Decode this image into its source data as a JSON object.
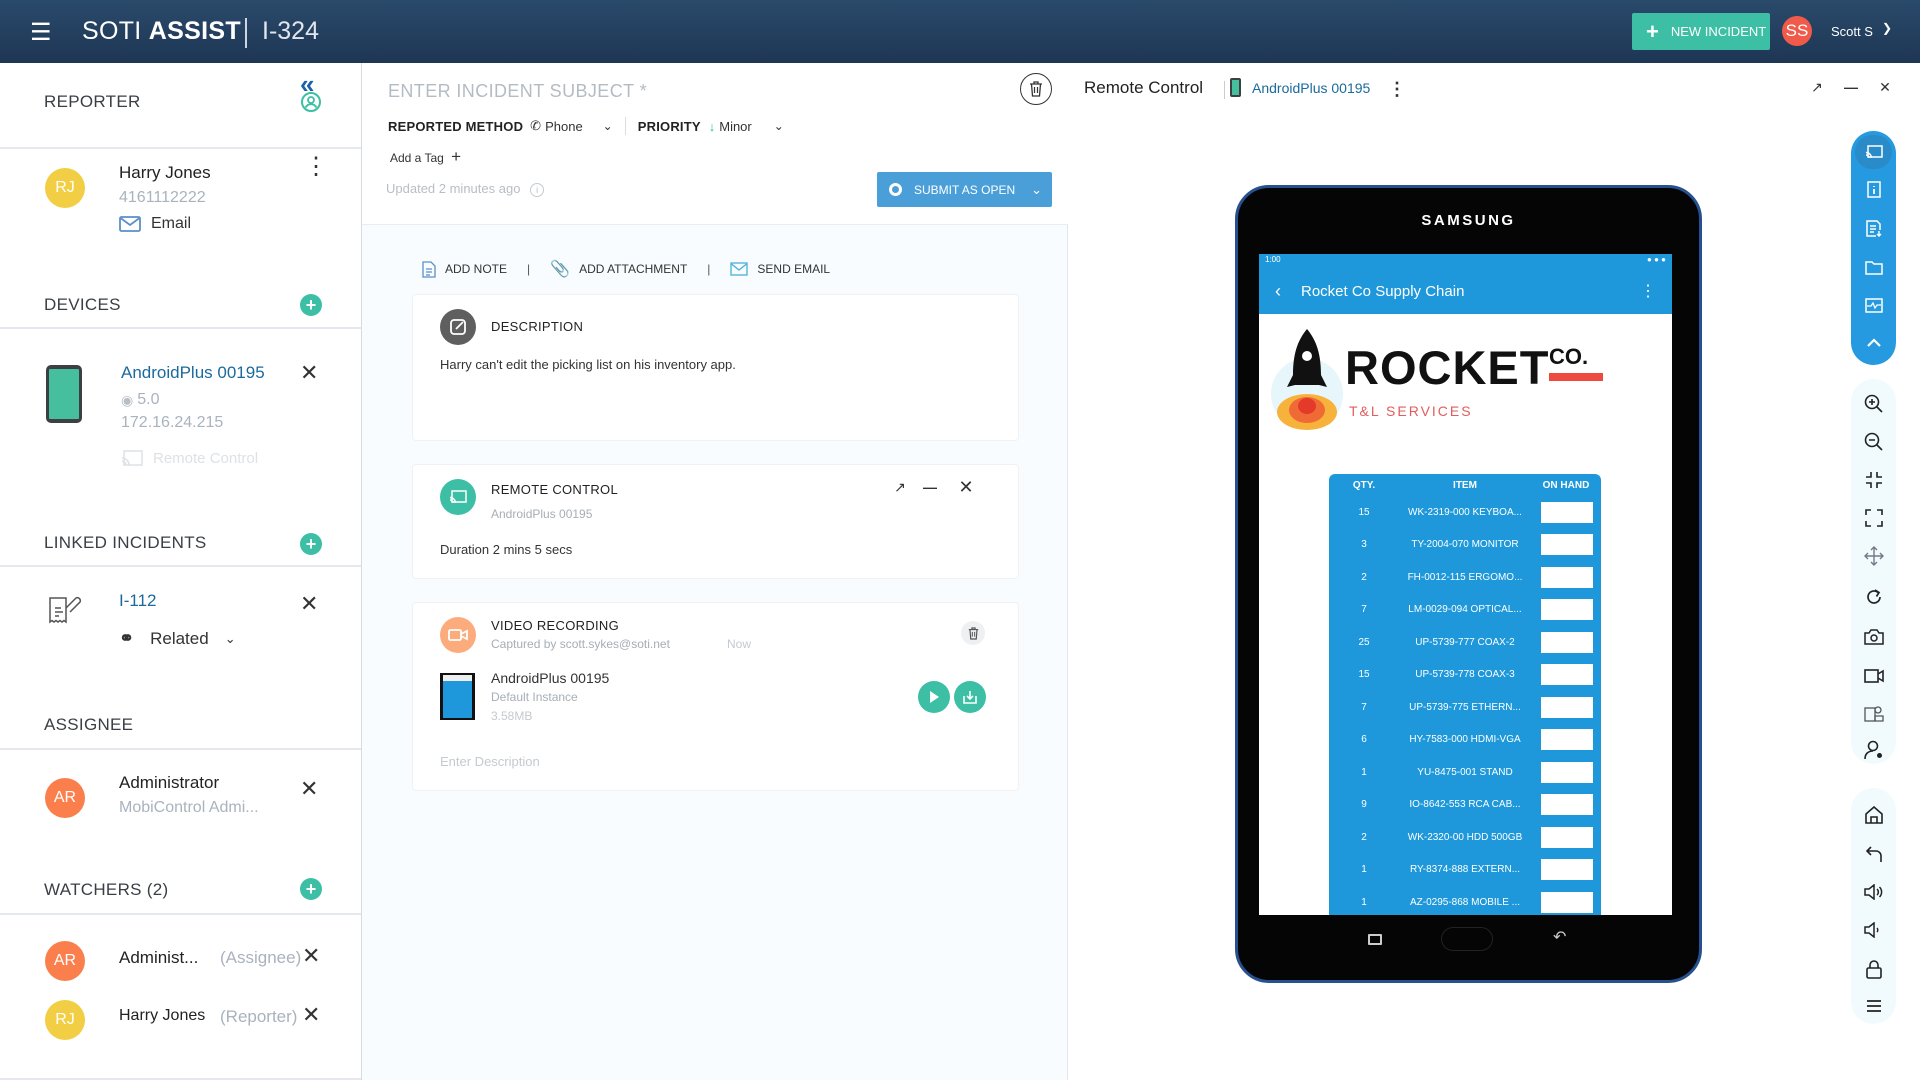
{
  "header": {
    "menu_icon": "hamburger-icon",
    "brand_light": "SOTI",
    "brand_bold": "ASSIST",
    "incident_id": "I-324",
    "new_incident_label": "NEW INCIDENT",
    "user_initials": "SS",
    "user_name": "Scott S",
    "colors": {
      "bar": "#1e3654",
      "new_incident": "#3dbfa5",
      "user_avatar": "#f05a4a"
    }
  },
  "sidebar": {
    "reporter": {
      "title": "REPORTER",
      "initials": "RJ",
      "name": "Harry Jones",
      "phone": "4161112222",
      "email_label": "Email"
    },
    "devices": {
      "title": "DEVICES",
      "name": "AndroidPlus 00195",
      "os_version": "5.0",
      "ip": "172.16.24.215",
      "remote_control_label": "Remote Control"
    },
    "linked_incidents": {
      "title": "LINKED INCIDENTS",
      "id": "I-112",
      "relation": "Related"
    },
    "assignee": {
      "title": "ASSIGNEE",
      "initials": "AR",
      "name": "Administrator",
      "role": "MobiControl Admi..."
    },
    "watchers": {
      "title": "WATCHERS (2)",
      "items": [
        {
          "initials": "AR",
          "name": "Administ...",
          "role": "(Assignee)",
          "color": "#fa7f4d"
        },
        {
          "initials": "RJ",
          "name": "Harry Jones",
          "role": "(Reporter)",
          "color": "#f2ce45"
        }
      ]
    }
  },
  "incident": {
    "subject_placeholder": "ENTER INCIDENT SUBJECT *",
    "reported_method_label": "REPORTED METHOD",
    "reported_method_value": "Phone",
    "priority_label": "PRIORITY",
    "priority_value": "Minor",
    "add_tag_label": "Add a Tag",
    "updated_text": "Updated 2 minutes ago",
    "submit_label": "SUBMIT AS OPEN",
    "actions": {
      "add_note": "ADD NOTE",
      "add_attachment": "ADD ATTACHMENT",
      "send_email": "SEND EMAIL"
    },
    "description": {
      "title": "DESCRIPTION",
      "text": "Harry can't edit the picking list on his inventory app."
    },
    "remote_control": {
      "title": "REMOTE CONTROL",
      "device": "AndroidPlus 00195",
      "duration": "Duration 2 mins 5 secs"
    },
    "video_recording": {
      "title": "VIDEO RECORDING",
      "captured_by": "Captured by scott.sykes@soti.net",
      "time": "Now",
      "file_name": "AndroidPlus 00195",
      "instance": "Default Instance",
      "size": "3.58MB",
      "description_placeholder": "Enter Description"
    }
  },
  "remote_panel": {
    "title": "Remote Control",
    "device": "AndroidPlus 00195",
    "tablet": {
      "brand": "SAMSUNG",
      "status_time": "1:00",
      "app_title": "Rocket Co Supply Chain",
      "logo_main": "ROCKET",
      "logo_co": "CO.",
      "logo_sub": "T&L SERVICES",
      "table_headers": [
        "QTY.",
        "ITEM",
        "ON HAND"
      ],
      "rows": [
        {
          "qty": "15",
          "item": "WK-2319-000 KEYBOA..."
        },
        {
          "qty": "3",
          "item": "TY-2004-070 MONITOR"
        },
        {
          "qty": "2",
          "item": "FH-0012-115 ERGOMO..."
        },
        {
          "qty": "7",
          "item": "LM-0029-094 OPTICAL..."
        },
        {
          "qty": "25",
          "item": "UP-5739-777 COAX-2"
        },
        {
          "qty": "15",
          "item": "UP-5739-778 COAX-3"
        },
        {
          "qty": "7",
          "item": "UP-5739-775 ETHERN..."
        },
        {
          "qty": "6",
          "item": "HY-7583-000 HDMI-VGA"
        },
        {
          "qty": "1",
          "item": "YU-8475-001 STAND"
        },
        {
          "qty": "9",
          "item": "IO-8642-553 RCA CAB..."
        },
        {
          "qty": "2",
          "item": "WK-2320-00 HDD 500GB"
        },
        {
          "qty": "1",
          "item": "RY-8374-888 EXTERN..."
        },
        {
          "qty": "1",
          "item": "AZ-0295-868 MOBILE ..."
        }
      ]
    },
    "toolbar_primary": [
      "remote-cast-icon",
      "device-info-icon",
      "file-download-icon",
      "folder-icon",
      "monitor-activity-icon",
      "chevron-up-icon"
    ],
    "toolbar_view": [
      "zoom-in-icon",
      "zoom-out-icon",
      "fit-screen-icon",
      "fullscreen-icon",
      "move-icon",
      "rotate-icon",
      "screenshot-camera-icon",
      "video-record-icon",
      "annotate-icon",
      "user-settings-icon"
    ],
    "toolbar_device": [
      "home-icon",
      "back-icon",
      "volume-up-icon",
      "volume-down-icon",
      "lock-icon",
      "menu-icon"
    ]
  }
}
